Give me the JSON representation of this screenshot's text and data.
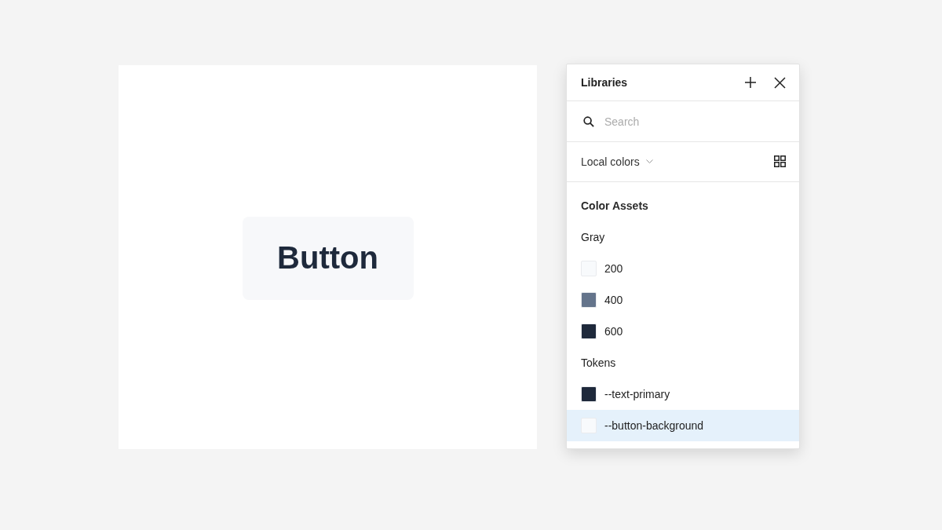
{
  "canvas": {
    "component": {
      "label": "Button"
    }
  },
  "panel": {
    "title": "Libraries",
    "search": {
      "placeholder": "Search"
    },
    "source": {
      "label": "Local colors"
    },
    "heading": "Color Assets",
    "groups": [
      {
        "title": "Gray",
        "items": [
          {
            "label": "200",
            "color": "#f8fafc",
            "selected": false
          },
          {
            "label": "400",
            "color": "#64748b",
            "selected": false
          },
          {
            "label": "600",
            "color": "#1e293b",
            "selected": false
          }
        ]
      },
      {
        "title": "Tokens",
        "items": [
          {
            "label": "--text-primary",
            "color": "#1e293b",
            "selected": false
          },
          {
            "label": "--button-background",
            "color": "#f8fafc",
            "selected": true
          }
        ]
      }
    ]
  }
}
